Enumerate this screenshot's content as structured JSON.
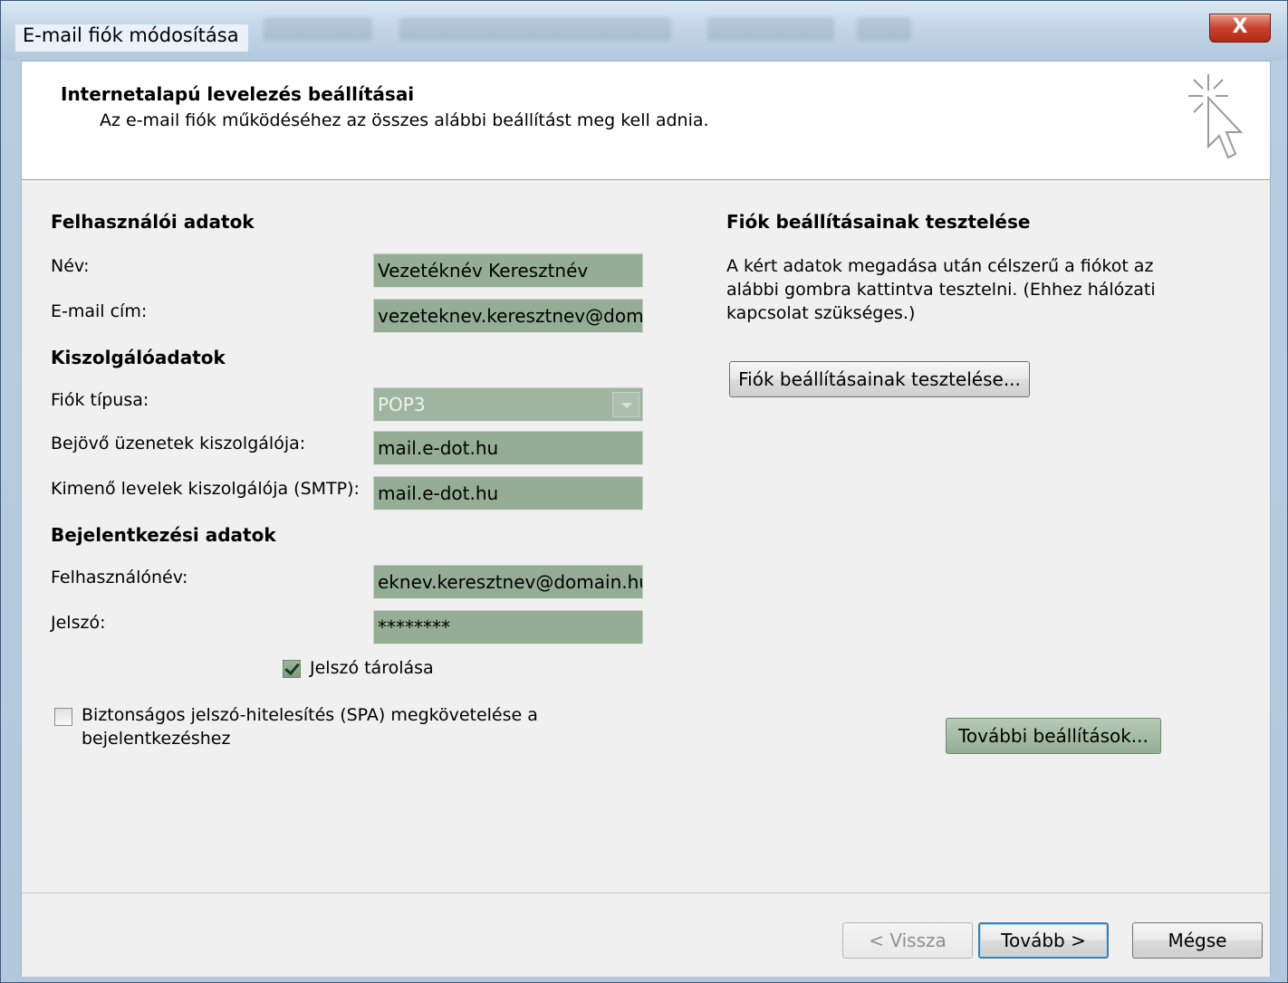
{
  "window": {
    "title": "E-mail fiók módosítása",
    "close_glyph": "X"
  },
  "header": {
    "title": "Internetalapú levelezés beállításai",
    "subtitle": "Az e-mail fiók működéséhez az összes alábbi beállítást meg kell adnia.",
    "icon": "click-cursor-icon"
  },
  "user_info": {
    "title": "Felhasználói adatok",
    "name_label": "Név:",
    "name_value": "Vezetéknév Keresztnév",
    "email_label": "E-mail cím:",
    "email_value": "vezeteknev.keresztnev@dom."
  },
  "server_info": {
    "title": "Kiszolgálóadatok",
    "type_label": "Fiók típusa:",
    "type_value": "POP3",
    "incoming_label": "Bejövő üzenetek kiszolgálója:",
    "incoming_value": "mail.e-dot.hu",
    "outgoing_label": "Kimenő levelek kiszolgálója (SMTP):",
    "outgoing_value": "mail.e-dot.hu"
  },
  "login_info": {
    "title": "Bejelentkezési adatok",
    "username_label": "Felhasználónév:",
    "username_value": "eknev.keresztnev@domain.hu",
    "password_label": "Jelszó:",
    "password_value": "********",
    "remember_label": "Jelszó tárolása",
    "remember_checked": true,
    "spa_label_line1": "Biztonságos jelszó-hitelesítés (SPA) megkövetelése a",
    "spa_label_line2": "bejelentkezéshez",
    "spa_checked": false
  },
  "test": {
    "title": "Fiók beállításainak tesztelése",
    "desc_line1": "A kért adatok megadása után célszerű a fiókot az",
    "desc_line2": "alábbi gombra kattintva tesztelni. (Ehhez hálózati",
    "desc_line3": "kapcsolat szükséges.)",
    "button": "Fiók beállításainak tesztelése..."
  },
  "more_settings_button": "További beállítások...",
  "footer": {
    "back": "< Vissza",
    "next": "Tovább >",
    "cancel": "Mégse"
  },
  "colors": {
    "field_bg": "#95ad95",
    "default_button_border": "#3c7fb1"
  }
}
